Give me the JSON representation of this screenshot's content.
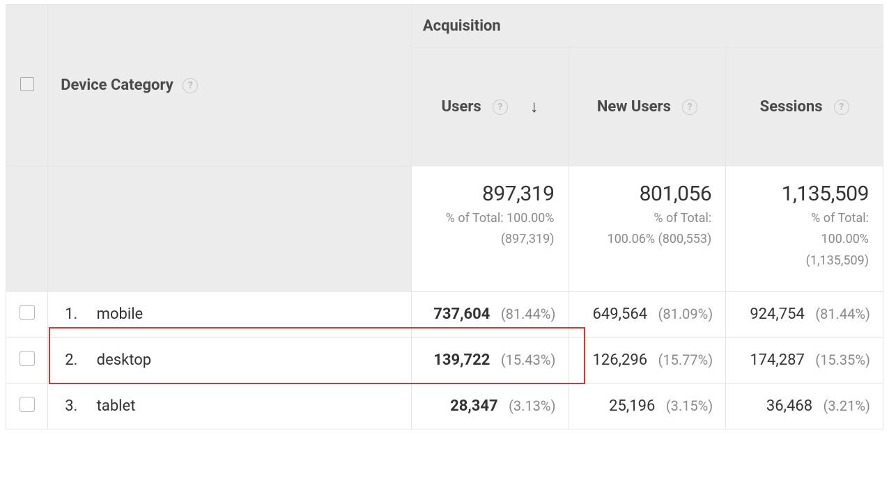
{
  "headers": {
    "dimension_label": "Device Category",
    "acquisition_label": "Acquisition",
    "metrics": {
      "users": "Users",
      "new_users": "New Users",
      "sessions": "Sessions"
    }
  },
  "summary": {
    "users": {
      "value": "897,319",
      "sub1": "% of Total: 100.00%",
      "sub2": "(897,319)"
    },
    "new_users": {
      "value": "801,056",
      "sub1": "% of Total:",
      "sub2": "100.06% (800,553)"
    },
    "sessions": {
      "value": "1,135,509",
      "sub1": "% of Total:",
      "sub2": "100.00%",
      "sub3": "(1,135,509)"
    }
  },
  "rows": [
    {
      "idx": "1.",
      "label": "mobile",
      "users": {
        "value": "737,604",
        "pct": "(81.44%)"
      },
      "new_users": {
        "value": "649,564",
        "pct": "(81.09%)"
      },
      "sessions": {
        "value": "924,754",
        "pct": "(81.44%)"
      }
    },
    {
      "idx": "2.",
      "label": "desktop",
      "users": {
        "value": "139,722",
        "pct": "(15.43%)"
      },
      "new_users": {
        "value": "126,296",
        "pct": "(15.77%)"
      },
      "sessions": {
        "value": "174,287",
        "pct": "(15.35%)"
      }
    },
    {
      "idx": "3.",
      "label": "tablet",
      "users": {
        "value": "28,347",
        "pct": "(3.13%)"
      },
      "new_users": {
        "value": "25,196",
        "pct": "(3.15%)"
      },
      "sessions": {
        "value": "36,468",
        "pct": "(3.21%)"
      }
    }
  ],
  "icons": {
    "help": "?",
    "sort_desc": "↓"
  }
}
